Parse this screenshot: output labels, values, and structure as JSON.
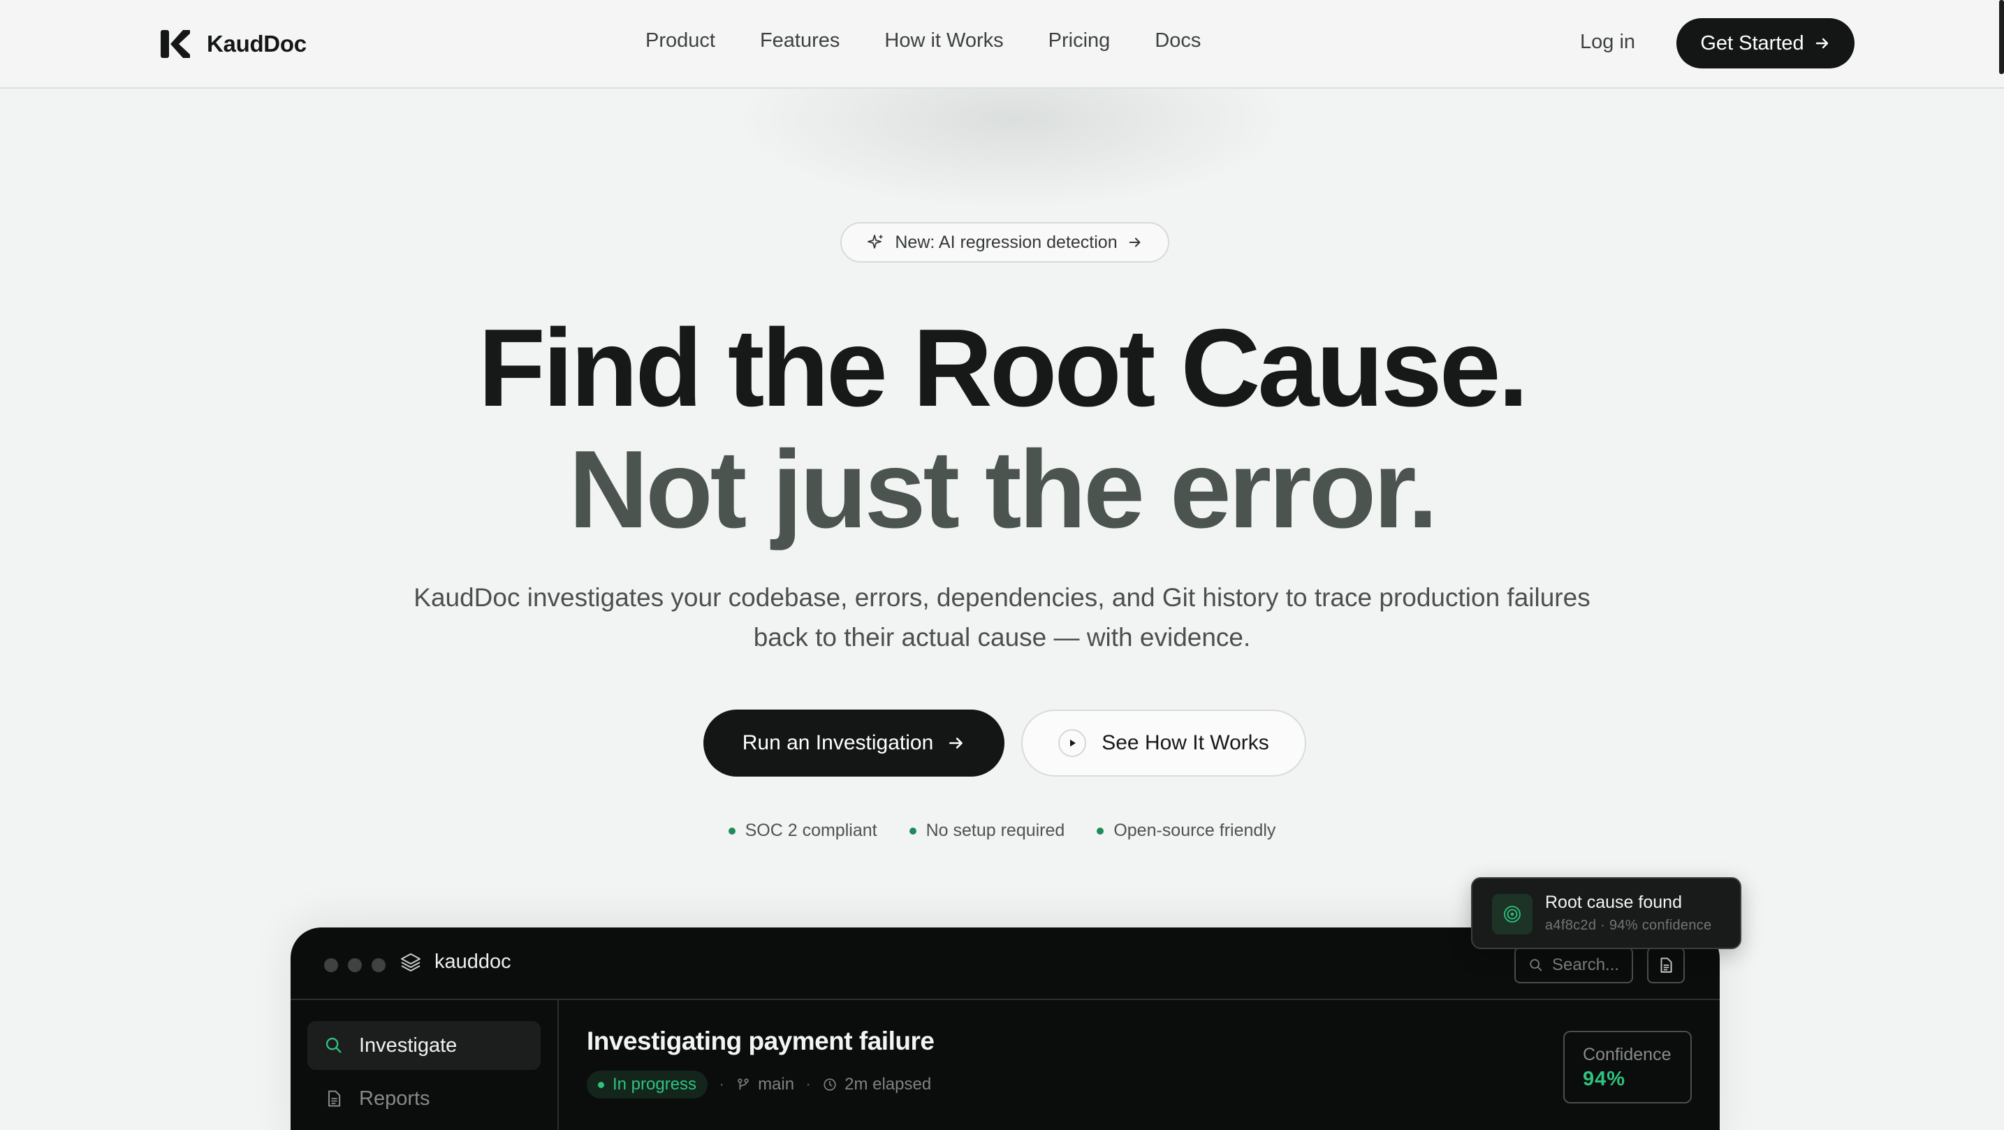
{
  "brand": {
    "name": "KaudDoc"
  },
  "nav": {
    "links": [
      "Product",
      "Features",
      "How it Works",
      "Pricing",
      "Docs"
    ],
    "login": "Log in",
    "cta": "Get Started"
  },
  "badge": {
    "text": "New: AI regression detection"
  },
  "hero": {
    "title_line1": "Find the Root Cause.",
    "title_line2": "Not just the error.",
    "subtitle_line1": "KaudDoc investigates your codebase, errors, dependencies, and Git history to trace production failures",
    "subtitle_line2": "back to their actual cause — with evidence.",
    "primary_button": "Run an Investigation",
    "secondary_button": "See How It Works",
    "trust": [
      "SOC 2 compliant",
      "No setup required",
      "Open-source friendly"
    ]
  },
  "app": {
    "brand": "kauddoc",
    "search_placeholder": "Search...",
    "sidebar": [
      "Investigate",
      "Reports"
    ],
    "investigation": {
      "title": "Investigating payment failure",
      "status": "In progress",
      "branch": "main",
      "elapsed": "2m elapsed",
      "confidence_label": "Confidence",
      "confidence_value": "94%"
    }
  },
  "toast": {
    "title": "Root cause found",
    "subtitle": "a4f8c2d · 94% confidence"
  },
  "colors": {
    "background": "#f2f4f3",
    "dark": "#131614",
    "accent_green": "#2fc37f",
    "trust_dot": "#1f8a5b"
  },
  "icons": [
    "k-logo-icon",
    "arrow-right-icon",
    "sparkle-icon",
    "play-icon",
    "layers-icon",
    "search-icon",
    "document-icon",
    "branch-icon",
    "clock-icon",
    "target-icon"
  ]
}
